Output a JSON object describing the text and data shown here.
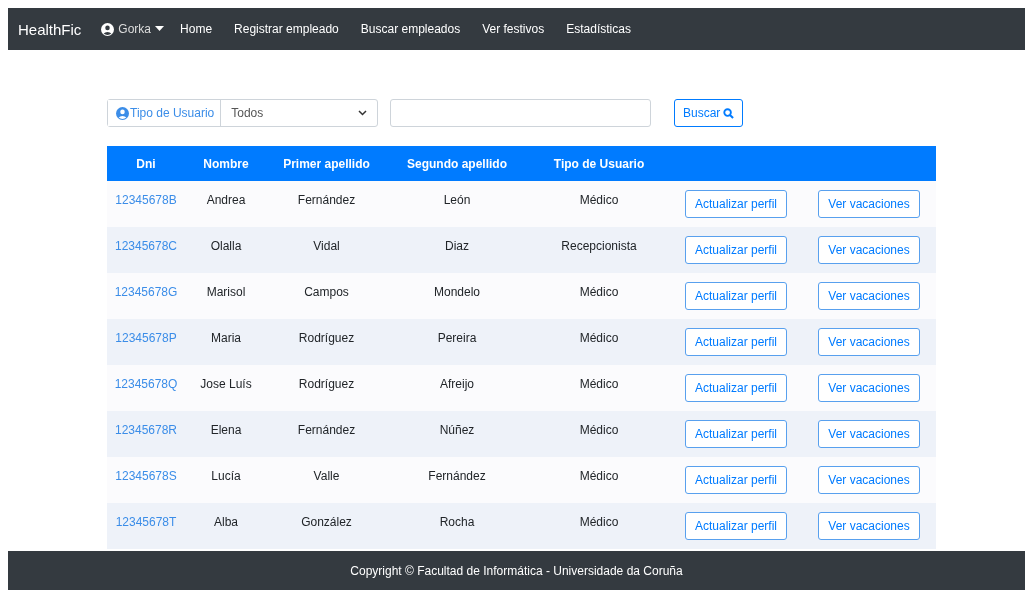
{
  "navbar": {
    "brand": "HealthFic",
    "user": "Gorka",
    "links": [
      "Home",
      "Registrar empleado",
      "Buscar empleados",
      "Ver festivos",
      "Estadísticas"
    ]
  },
  "search": {
    "type_label": "Tipo de Usuario",
    "type_value": "Todos",
    "button": "Buscar"
  },
  "table": {
    "columns": [
      "Dni",
      "Nombre",
      "Primer apellido",
      "Segundo apellido",
      "Tipo de Usuario"
    ],
    "rows": [
      {
        "dni": "12345678B",
        "nombre": "Andrea",
        "primer": "Fernández",
        "segundo": "León",
        "tipo": "Médico",
        "update": "Actualizar perfil",
        "vacations": "Ver vacaciones"
      },
      {
        "dni": "12345678C",
        "nombre": "Olalla",
        "primer": "Vidal",
        "segundo": "Diaz",
        "tipo": "Recepcionista",
        "update": "Actualizar perfil",
        "vacations": "Ver vacaciones"
      },
      {
        "dni": "12345678G",
        "nombre": "Marisol",
        "primer": "Campos",
        "segundo": "Mondelo",
        "tipo": "Médico",
        "update": "Actualizar perfil",
        "vacations": "Ver vacaciones"
      },
      {
        "dni": "12345678P",
        "nombre": "Maria",
        "primer": "Rodríguez",
        "segundo": "Pereira",
        "tipo": "Médico",
        "update": "Actualizar perfil",
        "vacations": "Ver vacaciones"
      },
      {
        "dni": "12345678Q",
        "nombre": "Jose Luís",
        "primer": "Rodríguez",
        "segundo": "Afreijo",
        "tipo": "Médico",
        "update": "Actualizar perfil",
        "vacations": "Ver vacaciones"
      },
      {
        "dni": "12345678R",
        "nombre": "Elena",
        "primer": "Fernández",
        "segundo": "Núñez",
        "tipo": "Médico",
        "update": "Actualizar perfil",
        "vacations": "Ver vacaciones"
      },
      {
        "dni": "12345678S",
        "nombre": "Lucía",
        "primer": "Valle",
        "segundo": "Fernández",
        "tipo": "Médico",
        "update": "Actualizar perfil",
        "vacations": "Ver vacaciones"
      },
      {
        "dni": "12345678T",
        "nombre": "Alba",
        "primer": "González",
        "segundo": "Rocha",
        "tipo": "Médico",
        "update": "Actualizar perfil",
        "vacations": "Ver vacaciones"
      }
    ]
  },
  "footer": "Copyright © Facultad de Informática - Universidade da Coruña"
}
